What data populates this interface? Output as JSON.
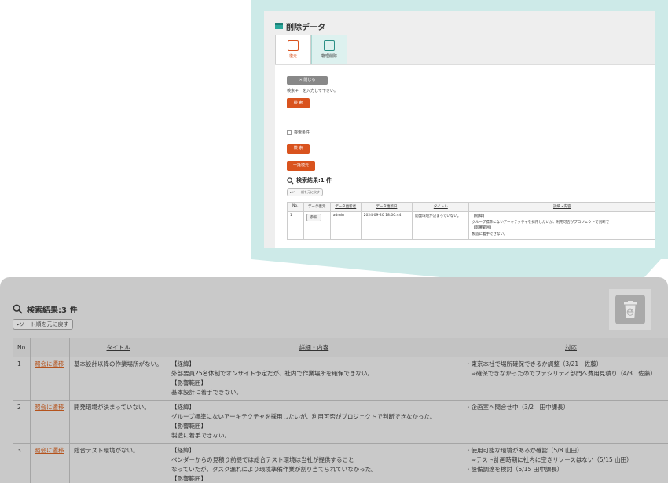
{
  "zoom": {
    "title": "削除データ",
    "tabs": [
      {
        "label": "復元"
      },
      {
        "label": "物理削除"
      }
    ],
    "close_button": "✕ 閉じる",
    "hint": "検索キーを入力して下さい。",
    "search_button_1": "検 索",
    "condition_label": "検索条件",
    "search_button_2": "検 索",
    "bulk_restore_button": "一括復元",
    "result_title": "検索結果:1 件",
    "sort_reset": "▸ソート順を元に戻す",
    "headers": [
      "No.",
      "データ復元",
      "データ更新者",
      "データ更新日",
      "タイトル",
      "詳細・内容"
    ],
    "rows": [
      {
        "no": "1",
        "ref": "参照",
        "updater": "admin",
        "date": "2024-09-20 18:00:44",
        "title": "開発環境が決まっていない。",
        "detail": [
          "【経緯】",
          "グループ標準にないアーキテクチャを採用したいが、利用可否がプロジェクトで判断で",
          "【影響範囲】",
          "製造に着手できない。"
        ]
      }
    ]
  },
  "main": {
    "result_title": "検索結果:3 件",
    "sort_reset": "▸ソート順を元に戻す",
    "headers": [
      "No",
      "",
      "タイトル",
      "詳細・内容",
      "対応"
    ],
    "rows": [
      {
        "no": "1",
        "link": "照会に遷移",
        "title": "基本設計以降の作業場所がない。",
        "detail": [
          "【経緯】",
          "外部要員25名体制でオンサイト予定だが、社内で作業場所を確保できない。",
          "【影響範囲】",
          "基本設計に着手できない。"
        ],
        "response": [
          "・東京本社で場所確保できるか調整（3/21　佐藤）",
          "　⇒確保できなかったのでファシリティ部門へ費用見積り（4/3　佐藤）"
        ]
      },
      {
        "no": "2",
        "link": "照会に遷移",
        "title": "開発環境が決まっていない。",
        "detail": [
          "【経緯】",
          "グループ標準にないアーキテクチャを採用したいが、利用可否がプロジェクトで判断できなかった。",
          "【影響範囲】",
          "製造に着手できない。"
        ],
        "response": [
          "・企画室へ問合せ中（3/2　田中課長）"
        ]
      },
      {
        "no": "3",
        "link": "照会に遷移",
        "title": "総合テスト環境がない。",
        "detail": [
          "【経緯】",
          "ベンダーからの見積り前提では総合テスト環境は当社が提供すること",
          "なっていたが、タスク漏れにより環境準備作業が割り当てられていなかった。",
          "【影響範囲】"
        ],
        "response": [
          "・使用可能な環境があるか確認（5/8 山田）",
          "　⇒テスト計画時期に社内に空きリソースはない（5/15 山田）",
          "・設備調達を検討（5/15 田中課長）"
        ]
      }
    ]
  }
}
